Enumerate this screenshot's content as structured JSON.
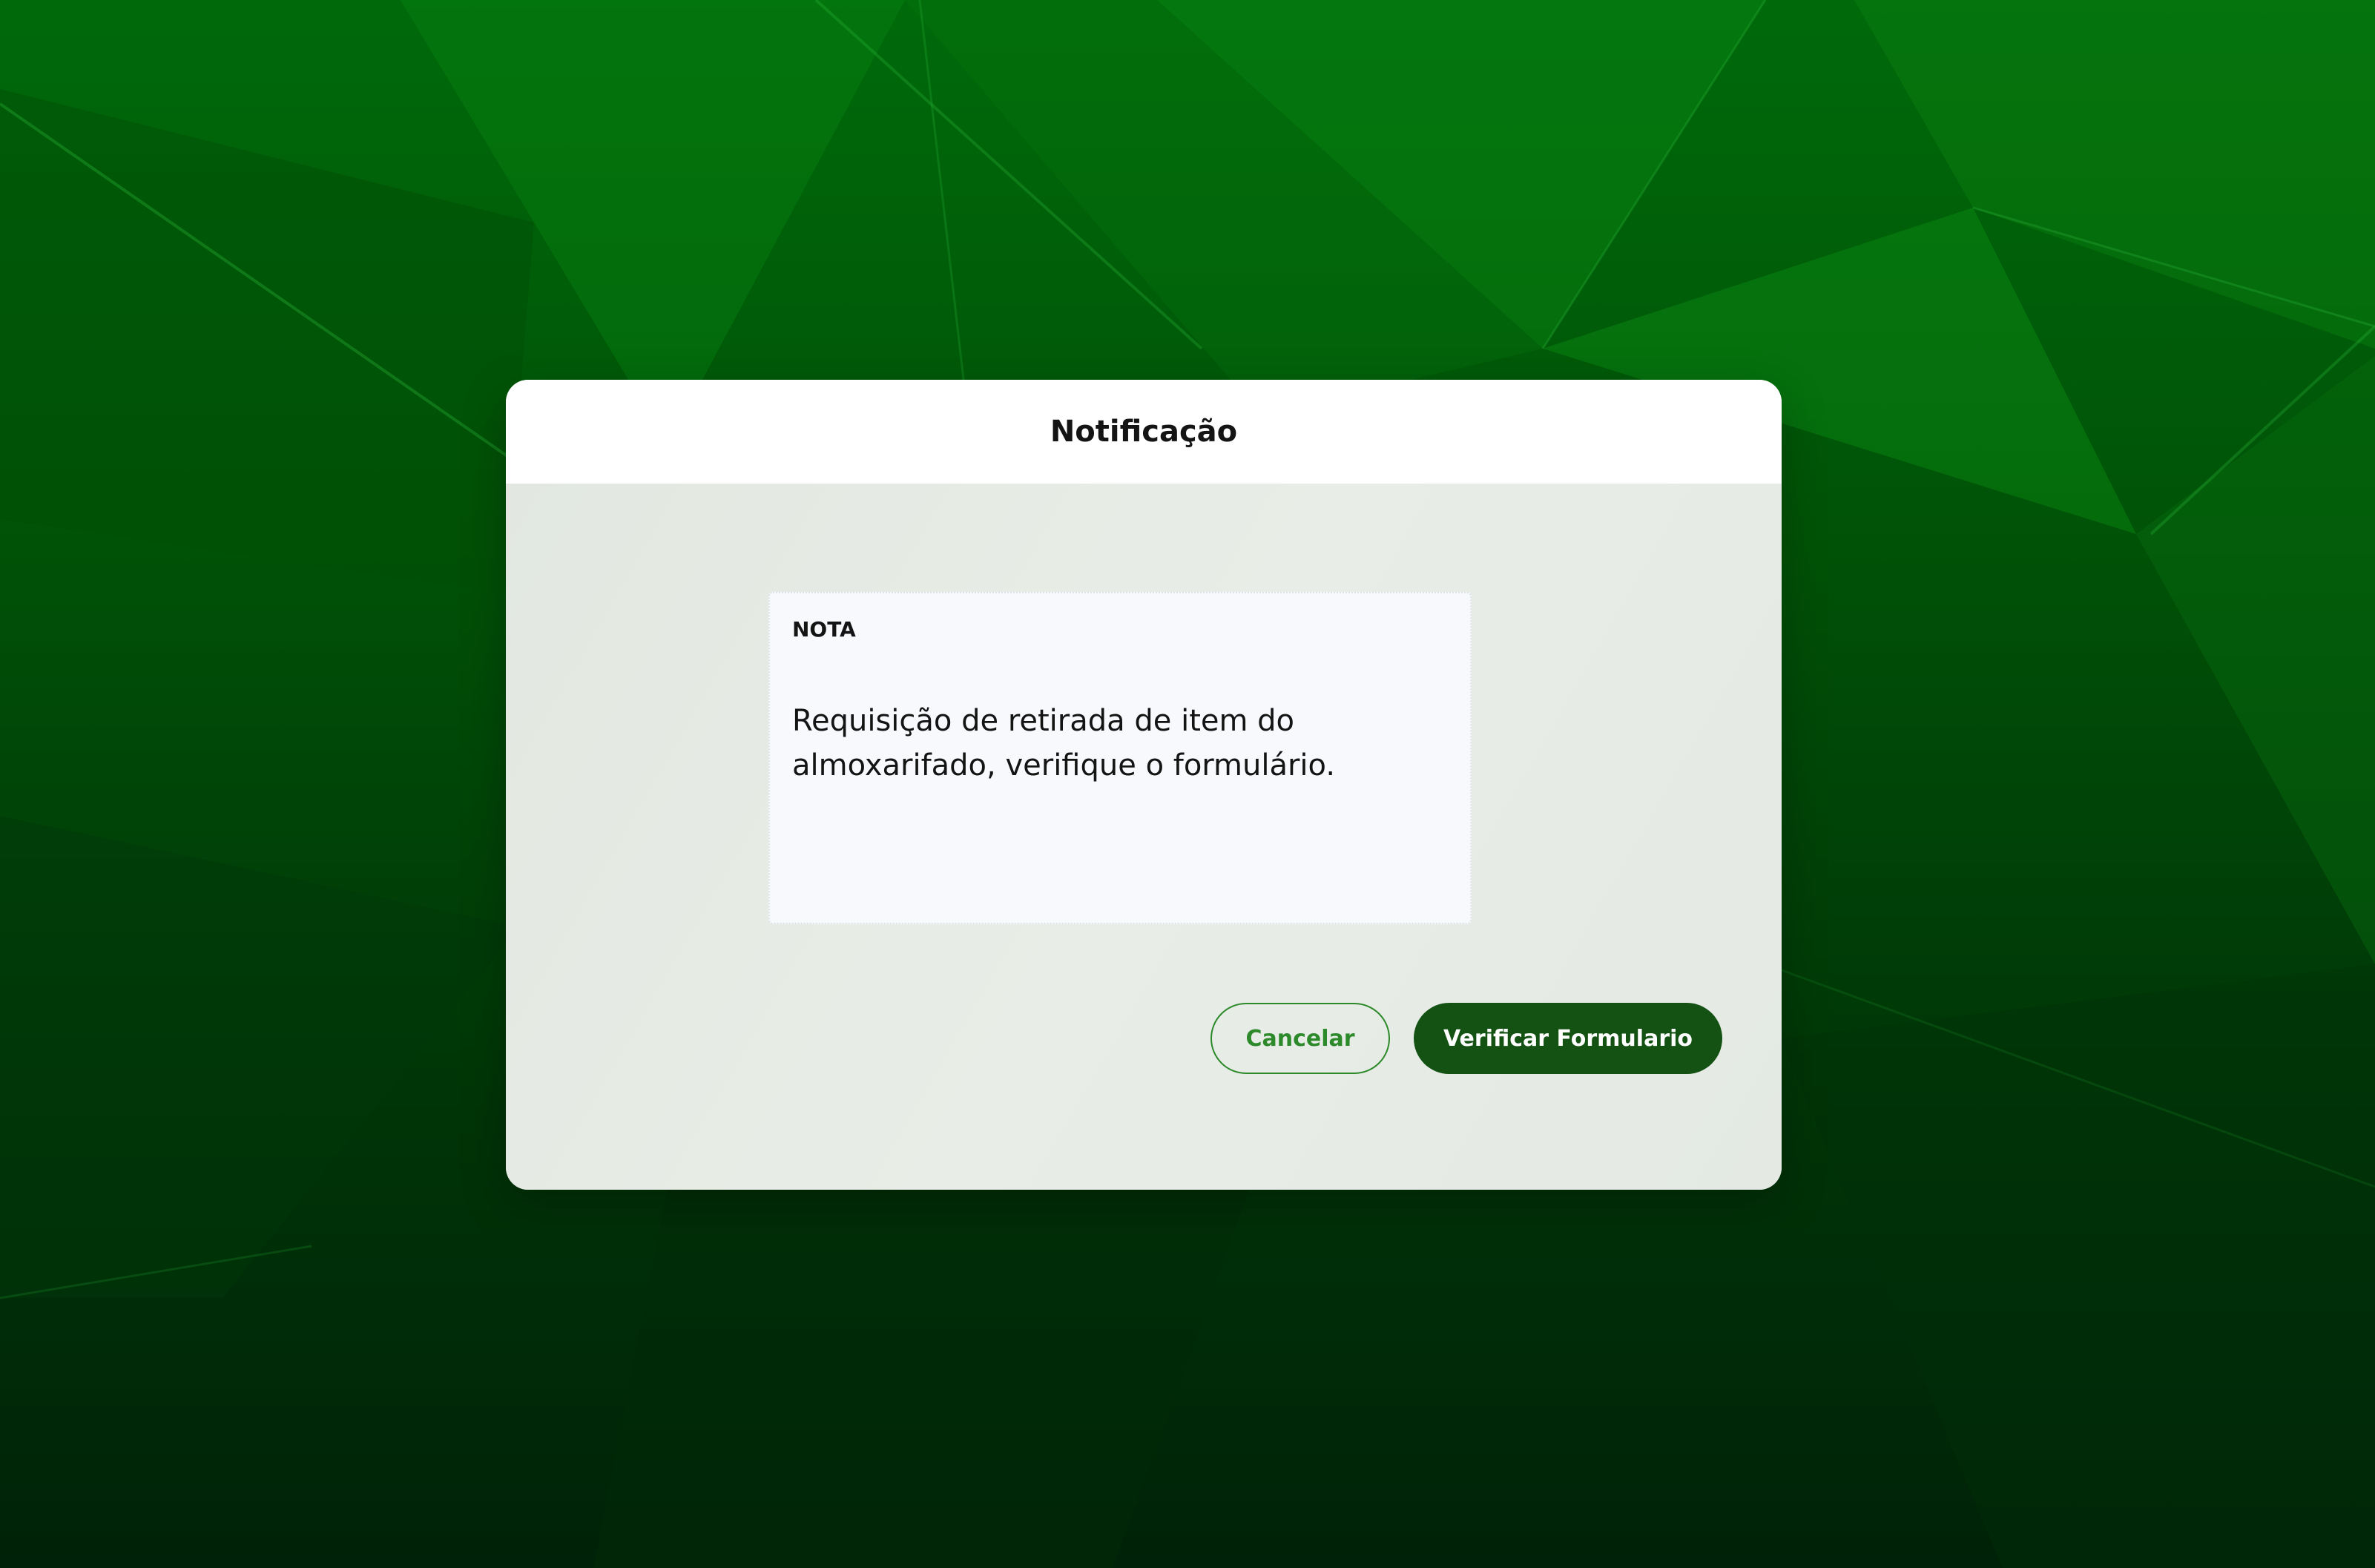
{
  "dialog": {
    "title": "Notificação",
    "note": {
      "label": "NOTA",
      "text": "Requisição de retirada de item do almoxarifado, verifique o formulário."
    },
    "buttons": {
      "cancel_label": "Cancelar",
      "verify_label": "Verificar Formulario"
    }
  },
  "colors": {
    "background_top": "#006a0a",
    "background_bottom": "#002208",
    "primary_button": "#145214",
    "cancel_border": "#2d8a2a",
    "dialog_body": "#e6ebe5",
    "note_background": "#f7f9fd"
  }
}
